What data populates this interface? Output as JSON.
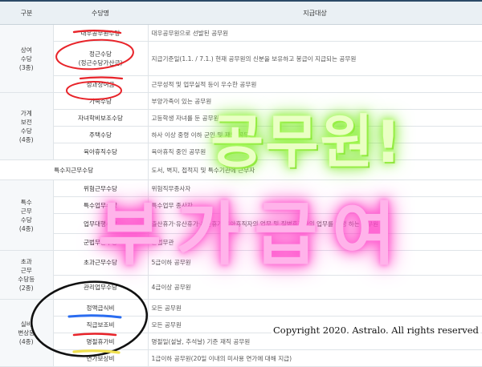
{
  "table": {
    "headers": [
      "구분",
      "수당명",
      "지급대상"
    ],
    "groups": {
      "g1": "상여\n수당\n(3종)",
      "g2": "가계\n보전\n수당\n(4종)",
      "g3": "특수\n근무\n수당\n(4종)",
      "g4": "초과\n근무\n수당등\n(2종)",
      "g5": "실비\n변상등\n(4종)"
    },
    "rows": [
      {
        "name": "대우공무원수당",
        "target": "대우공무원으로 선발된 공무원"
      },
      {
        "name": "정근수당\n(정근수당가산금)",
        "target": "지급기준일(1.1. / 7.1.) 현재 공무원의 신분을 보유하고 봉급이 지급되는 공무원"
      },
      {
        "name": "성과상여금",
        "target": "근무성적 및 업무실적 등이 우수한 공무원"
      },
      {
        "name": "가족수당",
        "target": "부양가족이 있는 공무원"
      },
      {
        "name": "자녀학비보조수당",
        "target": "고등학생 자녀를 둔 공무원"
      },
      {
        "name": "주택수당",
        "target": "하사 이상 중령 이하 군인 및 재외 공무원"
      },
      {
        "name": "육아휴직수당",
        "target": "육아휴직 중인 공무원"
      },
      {
        "name": "특수지근무수당",
        "target": "도서, 벽지, 접적지 및 특수기관에 근무자"
      },
      {
        "name": "위험근무수당",
        "target": "위험직무종사자"
      },
      {
        "name": "특수업무수당",
        "target": "특수업무 종사자"
      },
      {
        "name": "업무대행수당",
        "target": "출산휴가·유산휴가·사산휴가·육아휴직자의 업무 및 질병휴직자의 업무를 대행 하는 공무원"
      },
      {
        "name": "군법무관수당",
        "target": "군법무관"
      },
      {
        "name": "초과근무수당",
        "target": "5급이하 공무원"
      },
      {
        "name": "관리업무수당",
        "target": "4급이상 공무원"
      },
      {
        "name": "정액급식비",
        "target": "모든 공무원"
      },
      {
        "name": "직급보조비",
        "target": "모든 공무원"
      },
      {
        "name": "명절휴가비",
        "target": "명절일(설날, 추석날) 기준 재직 공무원"
      },
      {
        "name": "연가보상비",
        "target": "1급이하 공무원(20일 이내의 미사용 연가에 대해 지급)"
      }
    ]
  },
  "overlay": {
    "title_line1": "공무원!",
    "title_line2": "부가급여",
    "copyright": "Copyright 2020. Astralo. All rights reserved"
  },
  "colors": {
    "header_bg": "#eaf0f4",
    "header_border": "#2c4a66",
    "red_marker": "#e8242a",
    "blue_marker": "#2a6cf0",
    "yellow_marker": "#f0e050",
    "green_glow": "#7eea2c",
    "pink_glow": "#ff3fc6"
  }
}
